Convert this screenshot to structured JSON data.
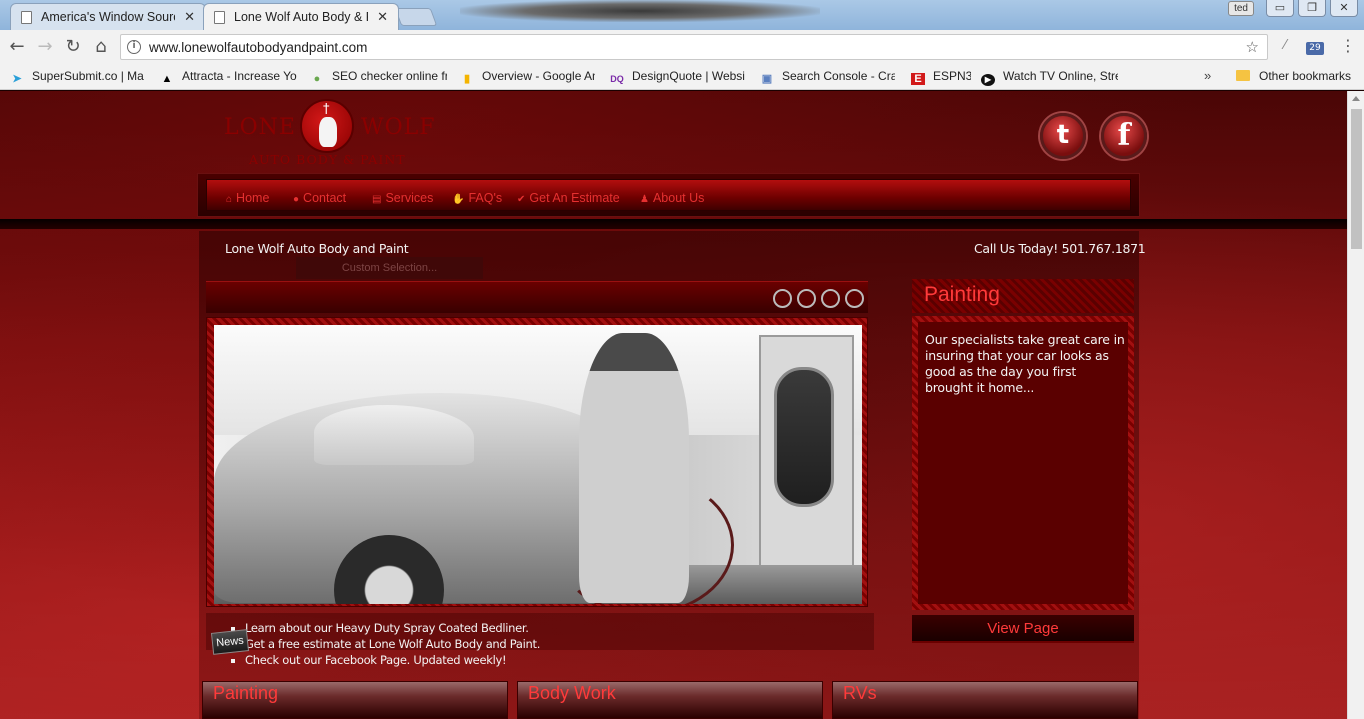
{
  "browser": {
    "tabs": [
      {
        "title": "America's Window Source",
        "active": false
      },
      {
        "title": "Lone Wolf Auto Body & Paint",
        "active": true
      }
    ],
    "close_glyph": "✕",
    "user_badge": "ted",
    "window_buttons": {
      "minimize": "▭",
      "restore": "❐",
      "close": "✕"
    },
    "url": "www.lonewolfautobodyandpaint.com",
    "nav_icons": {
      "back": "←",
      "forward": "→",
      "reload": "↻",
      "home": "⌂",
      "info": "i",
      "star": "☆",
      "menu": "⋮"
    },
    "extensions": [
      {
        "icon": "acrobat-icon",
        "glyph": "⁄"
      },
      {
        "icon": "calendar-icon",
        "glyph": "29"
      }
    ],
    "bookmarks": [
      {
        "label": "SuperSubmit.co | Ma",
        "icon": "paper-plane-icon",
        "glyph": "➤",
        "color": "#2a9fd8"
      },
      {
        "label": "Attracta - Increase Yo",
        "icon": "attracta-icon",
        "glyph": "▲",
        "color": "#000000"
      },
      {
        "label": "SEO checker online fr",
        "icon": "seo-icon",
        "glyph": "●",
        "color": "#6aa84f"
      },
      {
        "label": "Overview - Google An",
        "icon": "analytics-icon",
        "glyph": "▮",
        "color": "#f4b400"
      },
      {
        "label": "DesignQuote | Websi",
        "icon": "designquote-icon",
        "glyph": "DQ",
        "color": "#7a2aa8"
      },
      {
        "label": "Search Console - Cra",
        "icon": "search-console-icon",
        "glyph": "▣",
        "color": "#5a7fbf"
      },
      {
        "label": "ESPN3",
        "icon": "espn-icon",
        "glyph": "E",
        "color": "#d21a1a"
      },
      {
        "label": "Watch TV Online, Stre",
        "icon": "play-icon",
        "glyph": "▶",
        "color": "#111111"
      }
    ],
    "more_bookmarks": "»",
    "other_bookmarks": "Other bookmarks"
  },
  "site": {
    "logo": {
      "word1": "LONE",
      "word2": "WOLF",
      "tagline": "AUTO BODY & PAINT",
      "cross": "†"
    },
    "social": {
      "twitter": "t",
      "facebook": "f"
    },
    "nav": [
      {
        "label": "Home",
        "icon": "home-icon",
        "glyph": "⌂"
      },
      {
        "label": "Contact",
        "icon": "chat-icon",
        "glyph": "●"
      },
      {
        "label": "Services",
        "icon": "book-icon",
        "glyph": "▤"
      },
      {
        "label": "FAQ's",
        "icon": "thumbs-up-icon",
        "glyph": "✋"
      },
      {
        "label": "Get An Estimate",
        "icon": "check-circle-icon",
        "glyph": "✔"
      },
      {
        "label": "About Us",
        "icon": "user-icon",
        "glyph": "♟"
      }
    ],
    "site_name": "Lone Wolf Auto Body and Paint",
    "call_us": "Call Us Today! 501.767.1871",
    "custom_selection": "Custom Selection...",
    "slider_dots": 4,
    "news_label": "News",
    "news": [
      "Learn about our Heavy Duty Spray Coated Bedliner.",
      "Get a free estimate at Lone Wolf Auto Body and Paint.",
      "Check out our Facebook Page. Updated weekly!"
    ],
    "side": {
      "title": "Painting",
      "text": "Our specialists take great care in insuring that your car looks as good as the day you first brought it home...",
      "button": "View Page"
    },
    "bottom_boxes": [
      "Painting",
      "Body Work",
      "RVs"
    ]
  },
  "colors": {
    "accent": "#ff3a3a",
    "nav_text": "#e53030",
    "brand_dark": "#5a0000"
  }
}
